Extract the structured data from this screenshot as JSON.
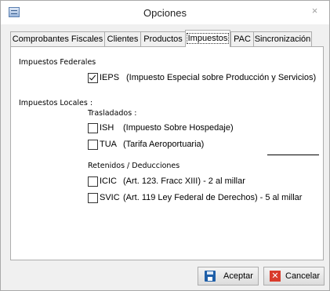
{
  "window": {
    "title": "Opciones",
    "close_glyph": "×"
  },
  "tabs": [
    {
      "label": "Comprobantes Fiscales",
      "active": false
    },
    {
      "label": "Clientes",
      "active": false
    },
    {
      "label": "Productos",
      "active": false
    },
    {
      "label": "Impuestos",
      "active": true
    },
    {
      "label": "PAC",
      "active": false
    },
    {
      "label": "Sincronización",
      "active": false
    }
  ],
  "federal": {
    "heading": "Impuestos Federales",
    "ieps": {
      "code": "IEPS",
      "desc": "(Impuesto Especial sobre Producción y Servicios)",
      "checked": true
    }
  },
  "local": {
    "heading": "Impuestos Locales :",
    "trasladados": {
      "heading": "Trasladados :",
      "items": [
        {
          "code": "ISH",
          "desc": "(Impuesto Sobre Hospedaje)",
          "checked": false
        },
        {
          "code": "TUA",
          "desc": "(Tarifa Aeroportuaria)",
          "checked": false
        }
      ]
    },
    "retenidos": {
      "heading": "Retenidos / Deducciones",
      "items": [
        {
          "code": "ICIC",
          "desc": "(Art. 123. Fracc XIII) - 2 al millar",
          "checked": false
        },
        {
          "code": "SVIC",
          "desc": "(Art. 119 Ley Federal de Derechos) - 5 al millar",
          "checked": false
        }
      ]
    }
  },
  "buttons": {
    "accept": "Aceptar",
    "cancel": "Cancelar"
  },
  "icons": {
    "app": "app-window-icon",
    "accept": "save-disk-icon",
    "cancel": "red-x-icon"
  },
  "colors": {
    "panel": "#ffffff",
    "dialog": "#f0f0f0",
    "save": "#1f5fa8",
    "cancel": "#d93b2b"
  }
}
